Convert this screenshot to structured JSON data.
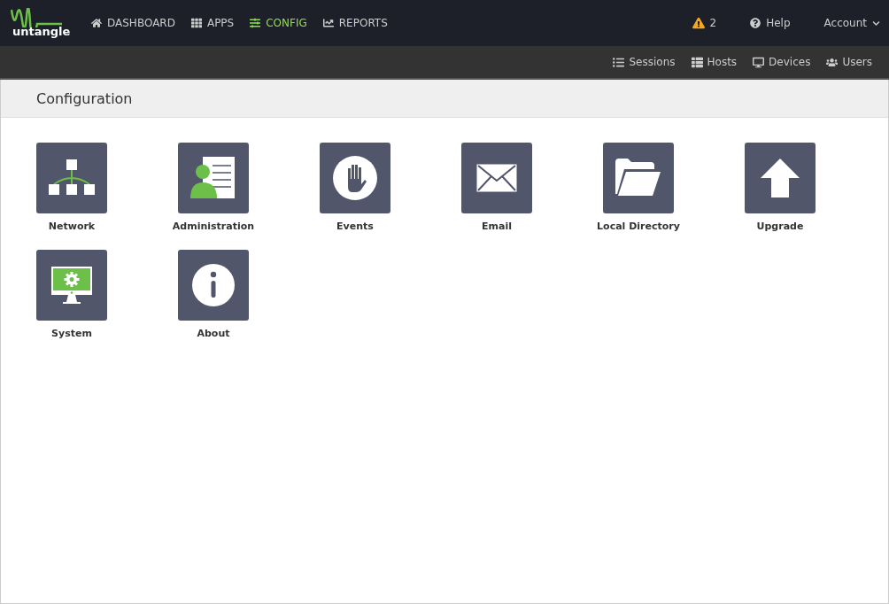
{
  "logo": {
    "text": "untangle"
  },
  "nav": [
    {
      "label": "DASHBOARD",
      "kind": "home",
      "selected": false
    },
    {
      "label": "APPS",
      "kind": "grid",
      "selected": false
    },
    {
      "label": "CONFIG",
      "kind": "sliders",
      "selected": true
    },
    {
      "label": "REPORTS",
      "kind": "chart",
      "selected": false
    }
  ],
  "top_right": {
    "alerts": "2",
    "help": "Help",
    "account": "Account"
  },
  "sub_nav": [
    {
      "label": "Sessions",
      "kind": "list"
    },
    {
      "label": "Hosts",
      "kind": "table"
    },
    {
      "label": "Devices",
      "kind": "monitor"
    },
    {
      "label": "Users",
      "kind": "users"
    }
  ],
  "page_title": "Configuration",
  "tiles": [
    {
      "label": "Network",
      "kind": "network"
    },
    {
      "label": "Administration",
      "kind": "admin"
    },
    {
      "label": "Events",
      "kind": "events"
    },
    {
      "label": "Email",
      "kind": "email"
    },
    {
      "label": "Local Directory",
      "kind": "folder"
    },
    {
      "label": "Upgrade",
      "kind": "upgrade"
    },
    {
      "label": "System",
      "kind": "system"
    },
    {
      "label": "About",
      "kind": "about"
    }
  ]
}
